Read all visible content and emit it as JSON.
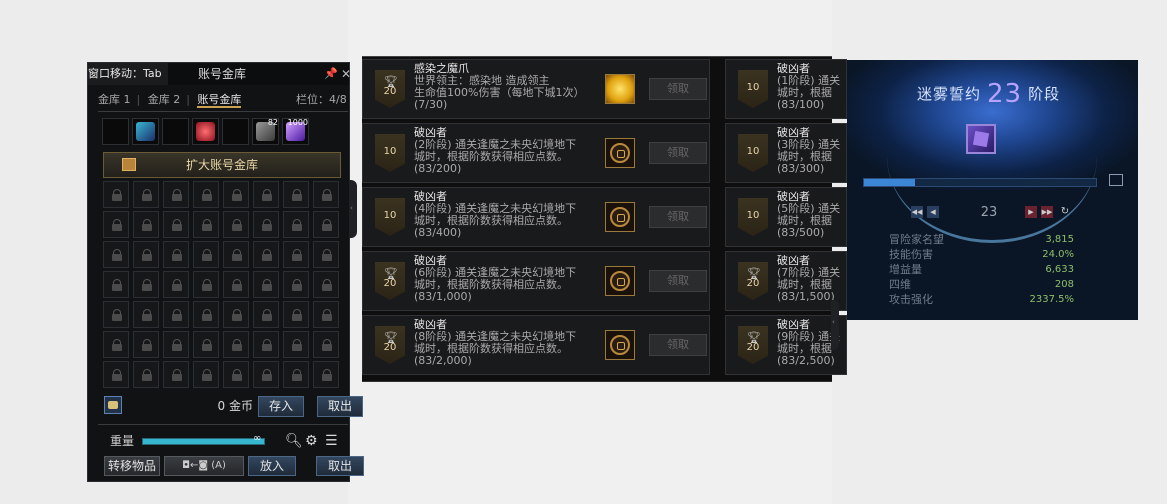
{
  "storage": {
    "move_label": "窗口移动：Tab",
    "title": "账号金库",
    "tabs": [
      "金库 1",
      "金库 2",
      "账号金库"
    ],
    "slots_label": "栏位：4/8",
    "top_badges": [
      "82",
      "1000"
    ],
    "expand_label": "扩大账号金库",
    "gold_amount": "0 金币",
    "deposit_label": "存入",
    "withdraw_label": "取出",
    "weight_label": "重量",
    "weight_infinity": "∞",
    "transfer_label": "转移物品",
    "transfer_hint": "◘←◙ (A)",
    "put_label": "放入",
    "take_label": "取出"
  },
  "achievements": {
    "claim_label": "领取",
    "left": [
      {
        "name": "感染之魔爪",
        "desc": "世界领主：感染地     造成领主\n生命值100%伤害（每地下城1次）",
        "progress": "(7/30)",
        "points": "20",
        "trophy": true,
        "reward": "gold"
      },
      {
        "name": "破凶者",
        "desc": "(2阶段) 通关逢魔之未央幻境地下\n城时，根据阶数获得相应点数。",
        "progress": "(83/200)",
        "points": "10",
        "trophy": false,
        "reward": "ring"
      },
      {
        "name": "破凶者",
        "desc": "(4阶段) 通关逢魔之未央幻境地下\n城时，根据阶数获得相应点数。",
        "progress": "(83/400)",
        "points": "10",
        "trophy": false,
        "reward": "ring"
      },
      {
        "name": "破凶者",
        "desc": "(6阶段) 通关逢魔之未央幻境地下\n城时，根据阶数获得相应点数。",
        "progress": "(83/1,000)",
        "points": "20",
        "trophy": true,
        "reward": "ring"
      },
      {
        "name": "破凶者",
        "desc": "(8阶段) 通关逢魔之未央幻境地下\n城时，根据阶数获得相应点数。",
        "progress": "(83/2,000)",
        "points": "20",
        "trophy": true,
        "reward": "ring"
      }
    ],
    "right": [
      {
        "name": "破凶者",
        "desc": "(1阶段) 通关\n城时，根据",
        "progress": "(83/100)",
        "points": "10",
        "trophy": false
      },
      {
        "name": "破凶者",
        "desc": "(3阶段) 通关\n城时，根据",
        "progress": "(83/300)",
        "points": "10",
        "trophy": false
      },
      {
        "name": "破凶者",
        "desc": "(5阶段) 通关\n城时，根据",
        "progress": "(83/500)",
        "points": "10",
        "trophy": false
      },
      {
        "name": "破凶者",
        "desc": "(7阶段) 通关\n城时，根据",
        "progress": "(83/1,500)",
        "points": "20",
        "trophy": true
      },
      {
        "name": "破凶者",
        "desc": "(9阶段) 通关\n城时，根据",
        "progress": "(83/2,500)",
        "points": "20",
        "trophy": true
      }
    ]
  },
  "pact": {
    "title_prefix": "迷雾誓约",
    "stage": "23",
    "title_suffix": "阶段",
    "progress_fraction": 0.22,
    "level": "23",
    "stats": [
      {
        "label": "冒险家名望",
        "value": "3,815"
      },
      {
        "label": "技能伤害",
        "value": "24.0%"
      },
      {
        "label": "增益量",
        "value": "6,633"
      },
      {
        "label": "四维",
        "value": "208"
      },
      {
        "label": "攻击强化",
        "value": "2337.5%"
      }
    ]
  }
}
